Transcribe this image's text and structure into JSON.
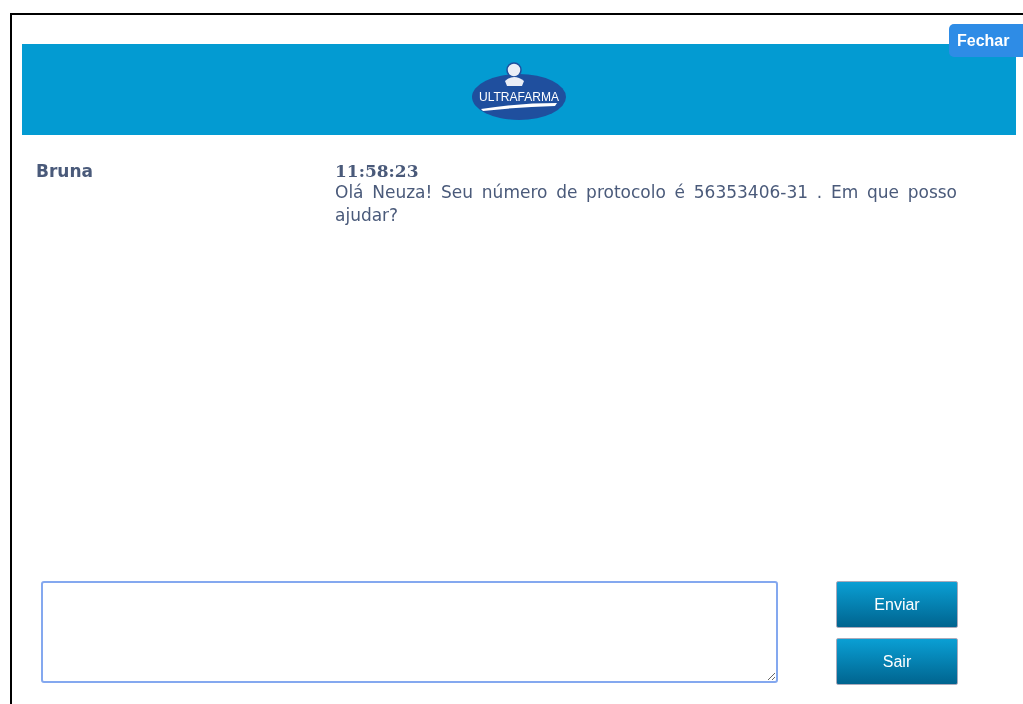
{
  "close_button": {
    "label": "Fechar"
  },
  "header": {
    "logo": "ULTRAFARMA"
  },
  "messages": [
    {
      "sender": "Bruna",
      "time": "11:58:23",
      "text": "Olá Neuza! Seu número de protocolo é 56353406-31 . Em que posso ajudar?"
    }
  ],
  "buttons": [
    {
      "label": "Enviar"
    },
    {
      "label": "Sair"
    }
  ]
}
